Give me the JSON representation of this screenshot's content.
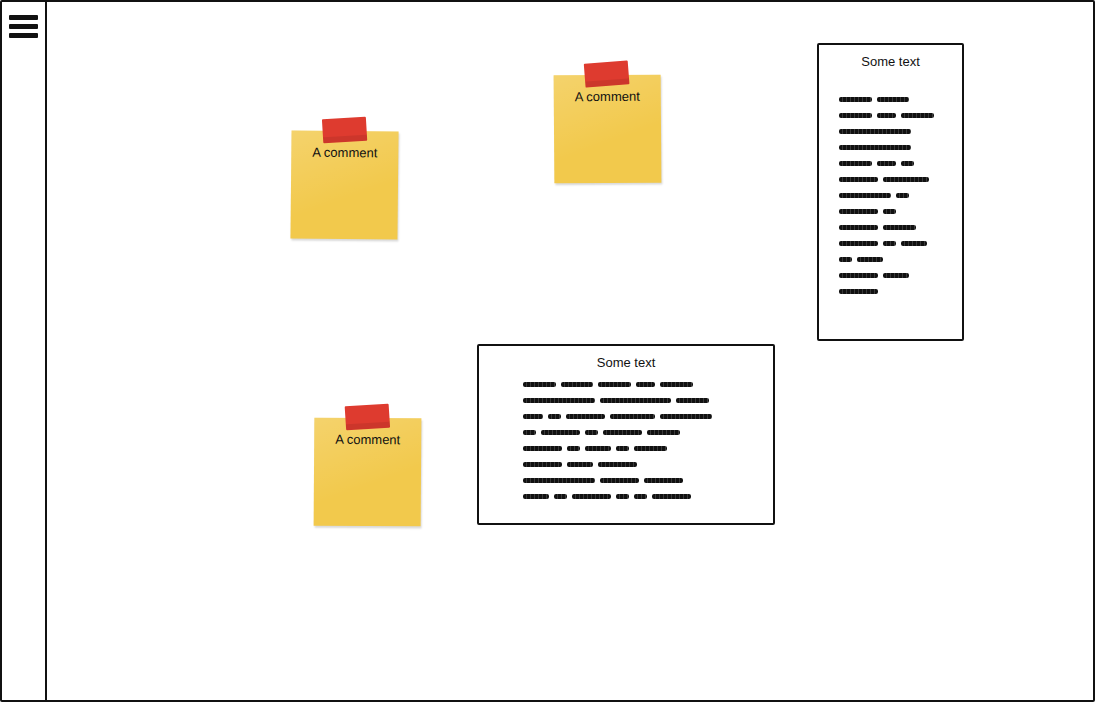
{
  "notes": [
    {
      "label": "A comment"
    },
    {
      "label": "A comment"
    },
    {
      "label": "A comment"
    }
  ],
  "panels": [
    {
      "title": "Some text",
      "lines": [
        [
          5,
          5
        ],
        [
          5,
          3,
          5
        ],
        [
          11
        ],
        [
          11
        ],
        [
          5,
          3,
          2
        ],
        [
          6,
          7
        ],
        [
          8,
          2
        ],
        [
          6,
          2
        ],
        [
          6,
          5
        ],
        [
          6,
          2,
          4
        ],
        [
          2,
          4
        ],
        [
          6,
          4
        ],
        [
          6
        ]
      ]
    },
    {
      "title": "Some text",
      "lines": [
        [
          5,
          5,
          5,
          3,
          5
        ],
        [
          11,
          11,
          5
        ],
        [
          3,
          2,
          6,
          7,
          8
        ],
        [
          2,
          6,
          2,
          6,
          5
        ],
        [
          6,
          2,
          4,
          2,
          5
        ],
        [
          6,
          4,
          6
        ],
        [
          11,
          6,
          6
        ],
        [
          4,
          2,
          6,
          2,
          2,
          6
        ]
      ]
    }
  ]
}
